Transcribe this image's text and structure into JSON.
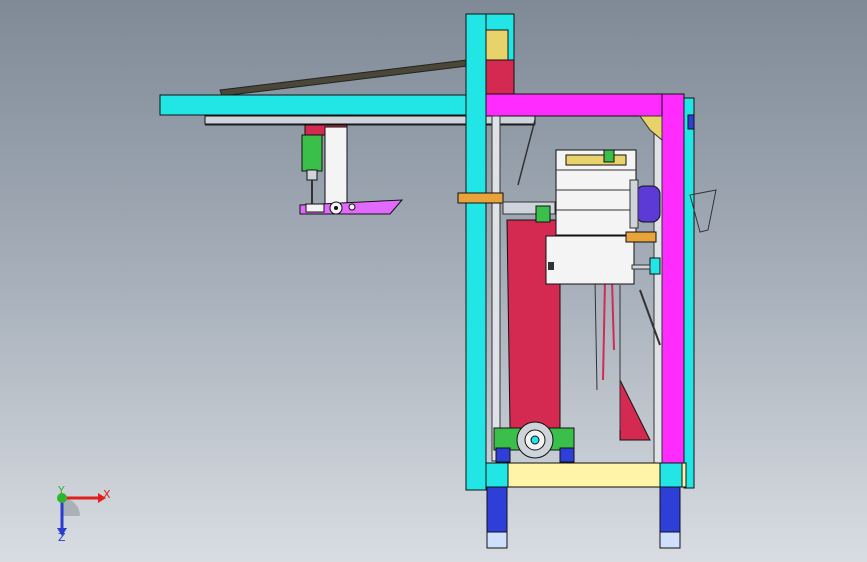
{
  "viewport": {
    "background_top": "#7f8a96",
    "background_bottom": "#d9dde2"
  },
  "triad": {
    "x_label": "X",
    "y_label": "Y",
    "z_label": "Z",
    "x_color": "#e0201c",
    "y_color": "#2fb52f",
    "z_color": "#2a3ccf"
  },
  "model_colors": {
    "frame_cyan": "#22e6e6",
    "frame_magenta": "#ff2bff",
    "panel_red": "#d42a52",
    "leg_blue": "#2d3fd6",
    "base_yellow": "#fff4a8",
    "part_white": "#f4f4f4",
    "motor_green": "#3ac04a",
    "bracket_orange": "#e8a43a",
    "belt_dark": "#4a4638",
    "arm_violet": "#e06aff"
  }
}
